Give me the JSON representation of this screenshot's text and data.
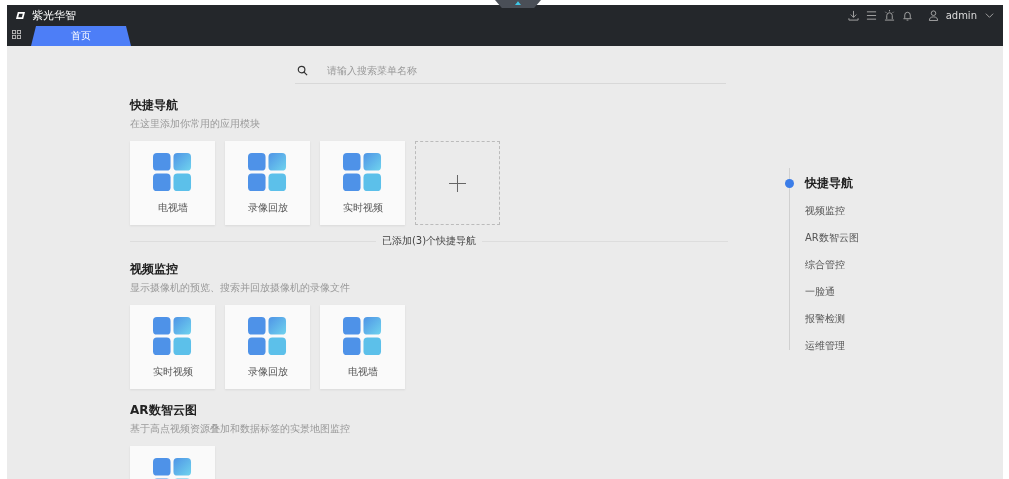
{
  "header": {
    "title": "紫光华智",
    "user": "admin",
    "tabs": [
      {
        "label": "首页",
        "selected": true
      }
    ]
  },
  "search": {
    "placeholder": "请输入搜索菜单名称"
  },
  "sections": [
    {
      "title": "快捷导航",
      "description": "在这里添加你常用的应用模块",
      "cards": [
        {
          "kind": "app",
          "label": "电视墙"
        },
        {
          "kind": "app",
          "label": "录像回放"
        },
        {
          "kind": "app",
          "label": "实时视频"
        },
        {
          "kind": "add"
        }
      ],
      "footer": "已添加(3)个快捷导航"
    },
    {
      "title": "视频监控",
      "description": "显示摄像机的预览、搜索并回放摄像机的录像文件",
      "cards": [
        {
          "kind": "app",
          "label": "实时视频"
        },
        {
          "kind": "app",
          "label": "录像回放"
        },
        {
          "kind": "app",
          "label": "电视墙"
        }
      ]
    },
    {
      "title": "AR数智云图",
      "description": "基于高点视频资源叠加和数据标签的实景地图监控",
      "cards": [
        {
          "kind": "app"
        }
      ]
    }
  ],
  "anchor_nav": [
    {
      "label": "快捷导航",
      "selected": true
    },
    {
      "label": "视频监控",
      "selected": false
    },
    {
      "label": "AR数智云图",
      "selected": false
    },
    {
      "label": "综合管控",
      "selected": false
    },
    {
      "label": "一脸通",
      "selected": false
    },
    {
      "label": "报警检测",
      "selected": false
    },
    {
      "label": "运维管理",
      "selected": false
    }
  ]
}
